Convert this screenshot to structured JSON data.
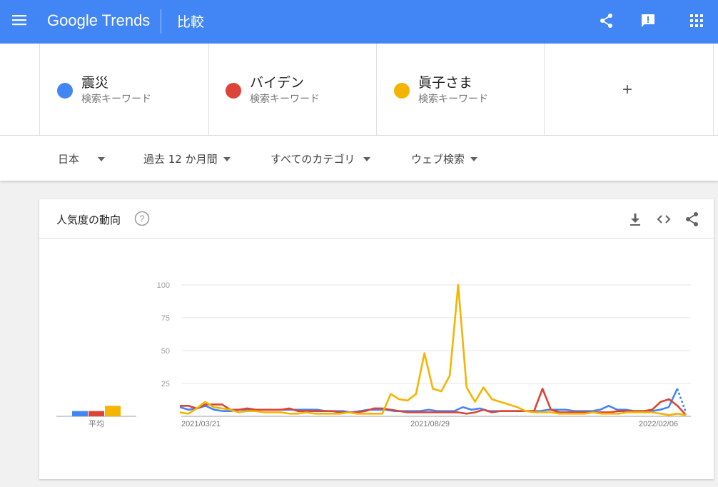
{
  "header": {
    "logo_text": "Google Trends",
    "page_title": "比較",
    "icons": [
      "menu-icon",
      "share-icon",
      "feedback-icon",
      "apps-grid-icon"
    ],
    "color": "#4285f4"
  },
  "terms": [
    {
      "name": "震災",
      "subtitle": "検索キーワード",
      "color": "#4285f4"
    },
    {
      "name": "バイデン",
      "subtitle": "検索キーワード",
      "color": "#db4437"
    },
    {
      "name": "眞子さま",
      "subtitle": "検索キーワード",
      "color": "#f4b400"
    }
  ],
  "add_term_label": "+",
  "filters": {
    "region": "日本",
    "period": "過去 12 か月間",
    "category": "すべてのカテゴリ",
    "search_type": "ウェブ検索"
  },
  "trend_card": {
    "title": "人気度の動向",
    "help_icon": "?",
    "icons": [
      "download-icon",
      "embed-icon",
      "share-icon"
    ]
  },
  "chart_data": {
    "type": "line",
    "yticks": [
      25,
      50,
      75,
      100
    ],
    "ylim": [
      0,
      100
    ],
    "x_labels": [
      "2021/03/21",
      "2021/08/29",
      "2022/02/06"
    ],
    "averages": {
      "label": "平均",
      "values": [
        4,
        4,
        8
      ],
      "colors": [
        "#4285f4",
        "#db4437",
        "#f4b400"
      ]
    },
    "series": [
      {
        "name": "震災",
        "color": "#4285f4",
        "partial_last": true,
        "values": [
          7,
          5,
          6,
          8,
          5,
          4,
          4,
          5,
          5,
          5,
          5,
          5,
          5,
          5,
          5,
          5,
          5,
          4,
          4,
          4,
          3,
          4,
          5,
          5,
          5,
          4,
          4,
          4,
          4,
          5,
          4,
          4,
          4,
          7,
          5,
          6,
          4,
          4,
          4,
          4,
          4,
          4,
          4,
          5,
          5,
          5,
          4,
          4,
          4,
          5,
          8,
          5,
          5,
          4,
          4,
          4,
          5,
          7,
          21,
          3
        ]
      },
      {
        "name": "バイデン",
        "color": "#db4437",
        "values": [
          8,
          8,
          6,
          9,
          9,
          9,
          5,
          5,
          6,
          5,
          5,
          5,
          5,
          6,
          4,
          4,
          4,
          4,
          4,
          3,
          3,
          3,
          4,
          6,
          6,
          5,
          4,
          3,
          3,
          3,
          3,
          3,
          3,
          3,
          2,
          3,
          5,
          3,
          4,
          4,
          4,
          4,
          4,
          21,
          5,
          3,
          3,
          3,
          3,
          3,
          3,
          3,
          4,
          4,
          4,
          4,
          5,
          11,
          13,
          8,
          1
        ]
      },
      {
        "name": "眞子さま",
        "color": "#f4b400",
        "values": [
          3,
          2,
          6,
          11,
          7,
          6,
          5,
          3,
          4,
          4,
          3,
          3,
          3,
          2,
          2,
          3,
          2,
          2,
          2,
          2,
          3,
          2,
          2,
          2,
          2,
          17,
          13,
          12,
          17,
          48,
          21,
          19,
          31,
          100,
          22,
          11,
          22,
          13,
          11,
          9,
          7,
          4,
          3,
          3,
          3,
          2,
          2,
          2,
          2,
          3,
          2,
          2,
          2,
          3,
          3,
          3,
          3,
          2,
          1,
          2,
          1
        ]
      }
    ]
  }
}
